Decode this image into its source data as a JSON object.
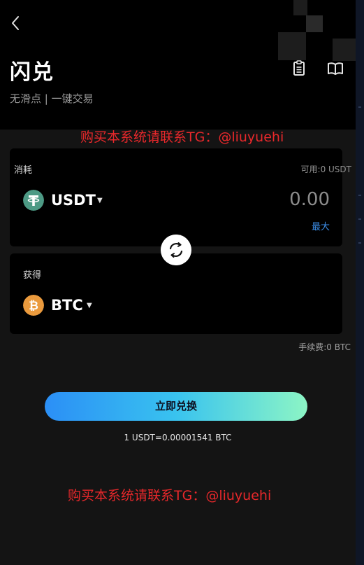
{
  "header": {
    "title": "闪兑",
    "subtitle": "无滑点 | 一键交易"
  },
  "watermark": {
    "text": "购买本系统请联系TG：@liuyuehi"
  },
  "pay": {
    "label": "消耗",
    "available": "可用:0 USDT",
    "coin": "USDT",
    "amount_placeholder": "0.00",
    "max_label": "最大"
  },
  "receive": {
    "label": "获得",
    "coin": "BTC"
  },
  "fee": "手续费:0 BTC",
  "action": {
    "button_label": "立即兑换",
    "rate": "1 USDT=0.00001541 BTC"
  },
  "colors": {
    "background": "#141414",
    "card": "#000000",
    "accent_blue": "#3b8de6",
    "watermark_red": "#e8282b",
    "usdt": "#4d9a85",
    "btc": "#ea9a3d",
    "button_gradient": [
      "#2b8ff6",
      "#39c3ef",
      "#8cf5c5"
    ]
  },
  "icons": {
    "back": "chevron-left-icon",
    "records": "clipboard-icon",
    "guide": "open-book-icon",
    "swap": "swap-arrows-icon",
    "caret": "caret-down-icon",
    "usdt": "tether-logo",
    "btc": "bitcoin-logo"
  }
}
